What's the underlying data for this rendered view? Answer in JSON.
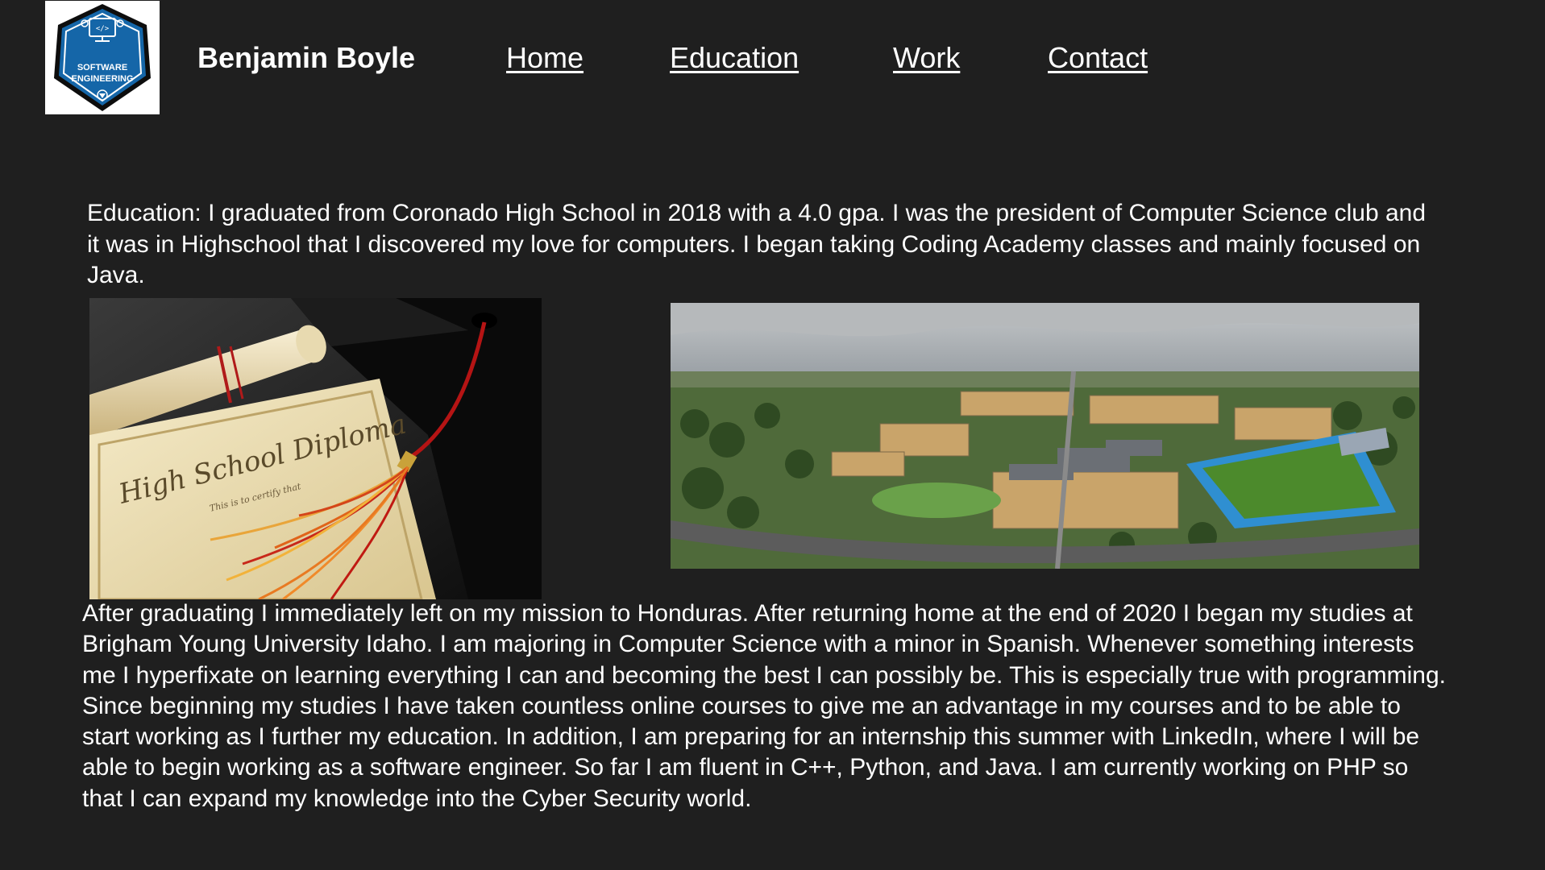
{
  "header": {
    "logo": {
      "icon": "software-engineering-badge",
      "line1": "SOFTWARE",
      "line2": "ENGINEERING",
      "badge_color": "#1566a8"
    },
    "site_name": "Benjamin Boyle",
    "nav": [
      {
        "label": "Home"
      },
      {
        "label": "Education"
      },
      {
        "label": "Work"
      },
      {
        "label": "Contact"
      }
    ]
  },
  "main": {
    "intro": "Education: I graduated from Coronado High School in 2018 with a 4.0 gpa. I was the president of Computer Science club and it was in Highschool that I discovered my love for computers. I began taking Coding Academy classes and mainly focused on Java.",
    "images": {
      "diploma": {
        "subject": "high-school-diploma-with-graduation-cap",
        "caption_text": "High School Diploma",
        "small_text": "This is to certify that"
      },
      "campus": {
        "subject": "aerial-view-of-university-campus"
      }
    },
    "body": "After graduating I immediately left on my mission to Honduras. After returning home at the end of 2020 I began my studies at Brigham Young University Idaho. I am majoring in Computer Science with a minor in Spanish. Whenever something interests me I hyperfixate on learning everything I can and becoming the best I can possibly be. This is especially true with programming. Since beginning my studies I have taken countless online courses to give me an advantage in my courses and to be able to start working as I further my education. In addition, I am preparing for an internship this summer with LinkedIn, where I will be able to begin working as a software engineer. So far I am fluent in C++, Python, and Java. I am currently working on PHP so that I can expand my knowledge into the Cyber Security world."
  },
  "colors": {
    "background": "#1f1f1f",
    "text": "#ffffff"
  }
}
